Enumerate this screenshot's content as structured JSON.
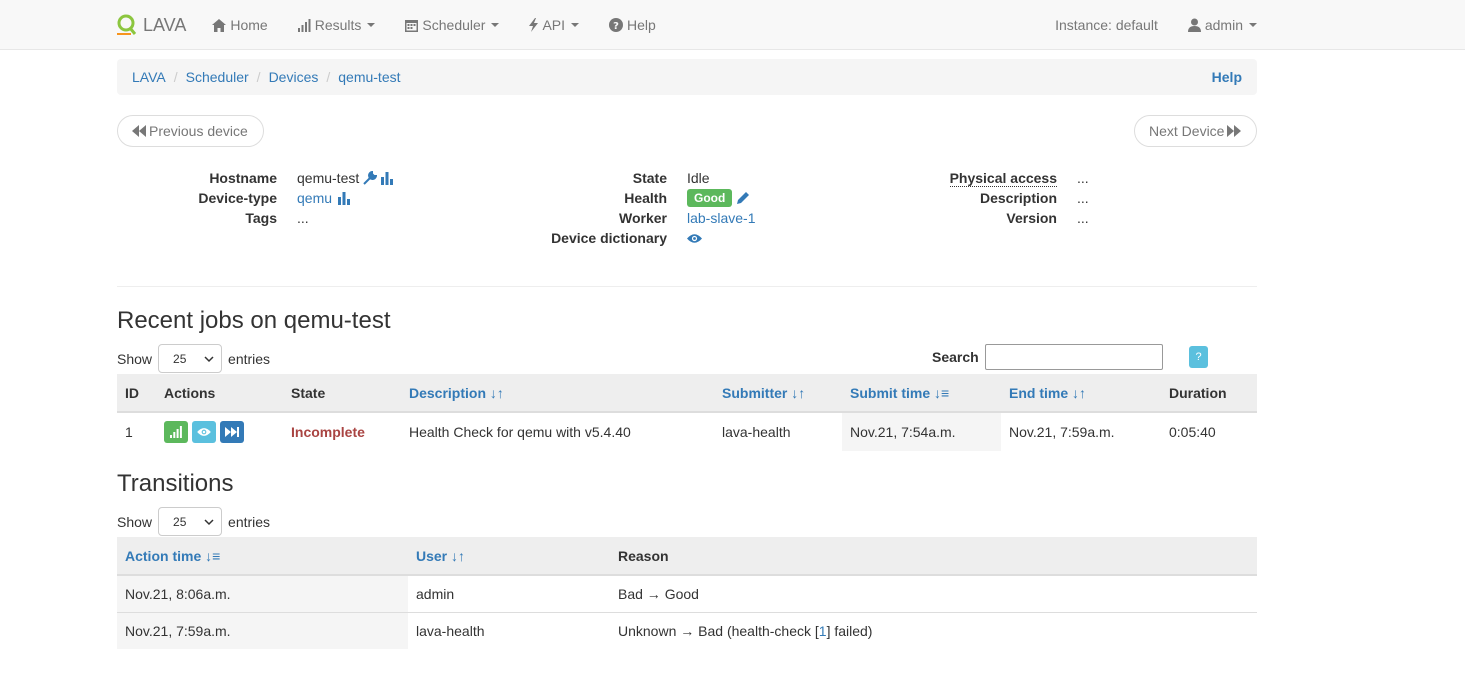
{
  "navbar": {
    "brand": "LAVA",
    "items": [
      {
        "label": "Home"
      },
      {
        "label": "Results"
      },
      {
        "label": "Scheduler"
      },
      {
        "label": "API"
      },
      {
        "label": "Help"
      }
    ],
    "instance": "Instance: default",
    "user": "admin"
  },
  "breadcrumb": {
    "items": [
      "LAVA",
      "Scheduler",
      "Devices",
      "qemu-test"
    ],
    "help": "Help"
  },
  "pager": {
    "previous": "Previous device",
    "next": "Next Device"
  },
  "device": {
    "col1": {
      "hostname_label": "Hostname",
      "hostname": "qemu-test",
      "devicetype_label": "Device-type",
      "devicetype": "qemu",
      "tags_label": "Tags",
      "tags": "..."
    },
    "col2": {
      "state_label": "State",
      "state": "Idle",
      "health_label": "Health",
      "health": "Good",
      "worker_label": "Worker",
      "worker": "lab-slave-1",
      "dict_label": "Device dictionary"
    },
    "col3": {
      "physical_label": "Physical access",
      "physical": "...",
      "description_label": "Description",
      "description": "...",
      "version_label": "Version",
      "version": "..."
    }
  },
  "jobs": {
    "title": "Recent jobs on qemu-test",
    "show": "Show",
    "entries": "entries",
    "page_size": "25",
    "search_label": "Search",
    "help_button": "?",
    "headers": [
      "ID",
      "Actions",
      "State",
      "Description",
      "Submitter",
      "Submit time",
      "End time",
      "Duration"
    ],
    "rows": [
      {
        "id": "1",
        "state": "Incomplete",
        "description": "Health Check for qemu with v5.4.40",
        "submitter": "lava-health",
        "submit_time": "Nov.21, 7:54a.m.",
        "end_time": "Nov.21, 7:59a.m.",
        "duration": "0:05:40"
      }
    ]
  },
  "transitions": {
    "title": "Transitions",
    "show": "Show",
    "entries": "entries",
    "page_size": "25",
    "headers": [
      "Action time",
      "User",
      "Reason"
    ],
    "rows": [
      {
        "time": "Nov.21, 8:06a.m.",
        "user": "admin",
        "reason": "Bad → Good"
      },
      {
        "time": "Nov.21, 7:59a.m.",
        "user": "lava-health",
        "reason_prefix": "Unknown → Bad (health-check [",
        "reason_link": "1",
        "reason_suffix": "] failed)"
      }
    ]
  },
  "colors": {
    "link": "#337ab7",
    "success": "#5cb85c",
    "info": "#5bc0de",
    "primary": "#337ab7",
    "danger": "#a94442"
  }
}
